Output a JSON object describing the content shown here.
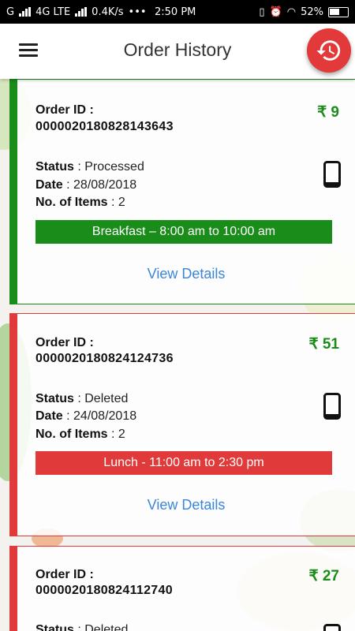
{
  "status_bar": {
    "carrier": "G",
    "network": "4G LTE",
    "speed": "0.4K/s",
    "dots": "•••",
    "time": "2:50 PM",
    "battery": "52%"
  },
  "app_bar": {
    "title": "Order History"
  },
  "labels": {
    "order_id": "Order ID :",
    "status": "Status",
    "date": "Date",
    "items": "No. of Items",
    "sep": " : ",
    "view_details": "View Details"
  },
  "orders": [
    {
      "id": "0000020180828143643",
      "price": "₹ 9",
      "status": "Processed",
      "date": "28/08/2018",
      "items": "2",
      "slot": "Breakfast – 8:00 am to 10:00 am",
      "color": "#1a8c1a"
    },
    {
      "id": "0000020180824124736",
      "price": "₹ 51",
      "status": "Deleted",
      "date": "24/08/2018",
      "items": "2",
      "slot": "Lunch - 11:00 am to 2:30 pm",
      "color": "#e03a3a"
    },
    {
      "id": "0000020180824112740",
      "price": "₹ 27",
      "status": "Deleted",
      "color": "#e03a3a"
    }
  ],
  "icons": {
    "menu": "hamburger-menu-icon",
    "history": "history-icon",
    "device": "mobile-phone-icon"
  },
  "colors": {
    "accent_red": "#e23a3a",
    "processed_green": "#1a8c1a",
    "deleted_red": "#e03a3a",
    "link_blue": "#3b86d8"
  }
}
